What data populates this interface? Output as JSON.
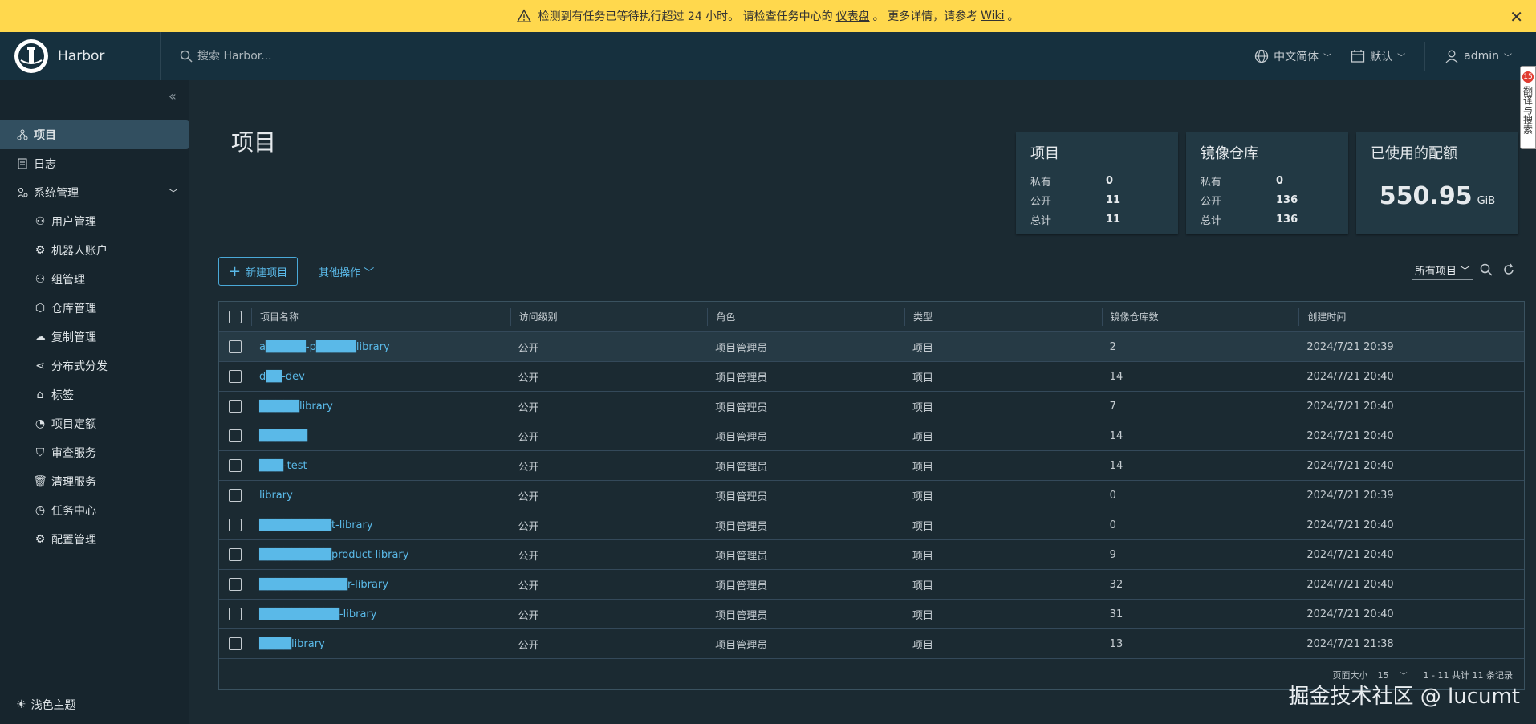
{
  "alert": {
    "message_pre": "检测到有任务已等待执行超过 24 小时。 请检查任务中心的",
    "link1": "仪表盘",
    "message_mid": "。 更多详情，请参考",
    "link2": "Wiki",
    "message_post": "。",
    "close": "✕"
  },
  "header": {
    "brand": "Harbor",
    "search_placeholder": "搜索 Harbor...",
    "language": "中文简体",
    "datetime_format": "默认",
    "user": "admin"
  },
  "side_tag": {
    "badge": "15",
    "text": "翻译与搜索"
  },
  "sidebar": {
    "collapse": "«",
    "items": [
      {
        "label": "项目"
      },
      {
        "label": "日志"
      },
      {
        "label": "系统管理"
      }
    ],
    "sub_items": [
      {
        "label": "用户管理"
      },
      {
        "label": "机器人账户"
      },
      {
        "label": "组管理"
      },
      {
        "label": "仓库管理"
      },
      {
        "label": "复制管理"
      },
      {
        "label": "分布式分发"
      },
      {
        "label": "标签"
      },
      {
        "label": "项目定额"
      },
      {
        "label": "审查服务"
      },
      {
        "label": "清理服务"
      },
      {
        "label": "任务中心"
      },
      {
        "label": "配置管理"
      }
    ],
    "theme": "浅色主题"
  },
  "main": {
    "title": "项目",
    "cards": {
      "projects": {
        "title": "项目",
        "private_label": "私有",
        "private": "0",
        "public_label": "公开",
        "public": "11",
        "total_label": "总计",
        "total": "11"
      },
      "repos": {
        "title": "镜像仓库",
        "private_label": "私有",
        "private": "0",
        "public_label": "公开",
        "public": "136",
        "total_label": "总计",
        "total": "136"
      },
      "quota": {
        "title": "已使用的配额",
        "value": "550.95",
        "unit": "GiB"
      }
    },
    "toolbar": {
      "new_project": "新建项目",
      "more_actions": "其他操作",
      "filter": "所有项目"
    },
    "table": {
      "columns": [
        "项目名称",
        "访问级别",
        "角色",
        "类型",
        "镜像仓库数",
        "创建时间"
      ],
      "rows": [
        {
          "name": "a█████-p█████library",
          "access": "公开",
          "role": "项目管理员",
          "type": "项目",
          "repos": "2",
          "created": "2024/7/21 20:39"
        },
        {
          "name": "d██-dev",
          "access": "公开",
          "role": "项目管理员",
          "type": "项目",
          "repos": "14",
          "created": "2024/7/21 20:40"
        },
        {
          "name": "█████library",
          "access": "公开",
          "role": "项目管理员",
          "type": "项目",
          "repos": "7",
          "created": "2024/7/21 20:40"
        },
        {
          "name": "██████",
          "access": "公开",
          "role": "项目管理员",
          "type": "项目",
          "repos": "14",
          "created": "2024/7/21 20:40"
        },
        {
          "name": "███-test",
          "access": "公开",
          "role": "项目管理员",
          "type": "项目",
          "repos": "14",
          "created": "2024/7/21 20:40"
        },
        {
          "name": "library",
          "access": "公开",
          "role": "项目管理员",
          "type": "项目",
          "repos": "0",
          "created": "2024/7/21 20:39"
        },
        {
          "name": "█████████t-library",
          "access": "公开",
          "role": "项目管理员",
          "type": "项目",
          "repos": "0",
          "created": "2024/7/21 20:40"
        },
        {
          "name": "█████████product-library",
          "access": "公开",
          "role": "项目管理员",
          "type": "项目",
          "repos": "9",
          "created": "2024/7/21 20:40"
        },
        {
          "name": "███████████r-library",
          "access": "公开",
          "role": "项目管理员",
          "type": "项目",
          "repos": "32",
          "created": "2024/7/21 20:40"
        },
        {
          "name": "██████████-library",
          "access": "公开",
          "role": "项目管理员",
          "type": "项目",
          "repos": "31",
          "created": "2024/7/21 20:40"
        },
        {
          "name": "████library",
          "access": "公开",
          "role": "项目管理员",
          "type": "项目",
          "repos": "13",
          "created": "2024/7/21 21:38"
        }
      ]
    },
    "pagination": {
      "page_size_label": "页面大小",
      "page_size": "15",
      "summary": "1 - 11 共计 11 条记录"
    }
  },
  "watermark": "掘金技术社区 @ lucumt"
}
